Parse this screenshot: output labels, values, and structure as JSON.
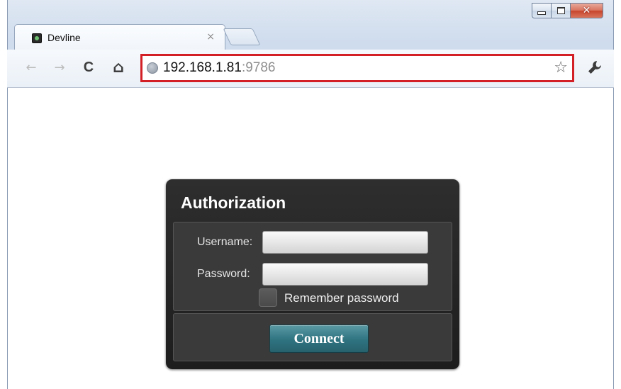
{
  "window": {
    "caption_buttons": [
      "minimize",
      "maximize",
      "close"
    ]
  },
  "tabs": [
    {
      "title": "Devline",
      "close_glyph": "×",
      "favicon": "devline-favicon"
    }
  ],
  "toolbar": {
    "back_glyph": "←",
    "forward_glyph": "→",
    "reload_glyph": "C",
    "home_glyph": "⌂",
    "url_host": "192.168.1.81",
    "url_port": ":9786",
    "star_glyph": "☆",
    "wrench_glyph": "🔧",
    "highlight_color": "#d32027"
  },
  "dialog": {
    "title": "Authorization",
    "username_label": "Username:",
    "username_value": "",
    "password_label": "Password:",
    "password_value": "",
    "remember_label": "Remember password",
    "remember_checked": false,
    "connect_label": "Connect",
    "accent_color": "#2f7380"
  }
}
